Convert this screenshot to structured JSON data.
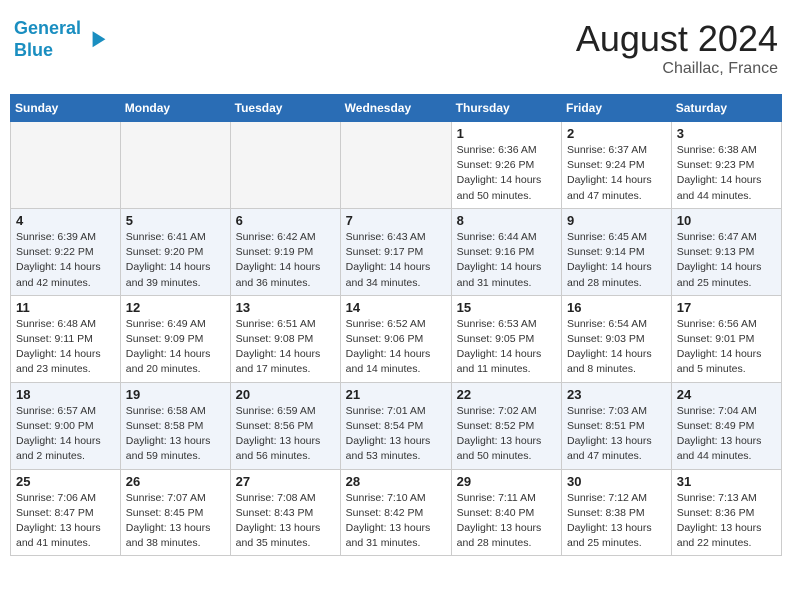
{
  "header": {
    "logo_line1": "General",
    "logo_line2": "Blue",
    "month": "August 2024",
    "location": "Chaillac, France"
  },
  "days_of_week": [
    "Sunday",
    "Monday",
    "Tuesday",
    "Wednesday",
    "Thursday",
    "Friday",
    "Saturday"
  ],
  "weeks": [
    [
      {
        "day": "",
        "info": ""
      },
      {
        "day": "",
        "info": ""
      },
      {
        "day": "",
        "info": ""
      },
      {
        "day": "",
        "info": ""
      },
      {
        "day": "1",
        "info": "Sunrise: 6:36 AM\nSunset: 9:26 PM\nDaylight: 14 hours\nand 50 minutes."
      },
      {
        "day": "2",
        "info": "Sunrise: 6:37 AM\nSunset: 9:24 PM\nDaylight: 14 hours\nand 47 minutes."
      },
      {
        "day": "3",
        "info": "Sunrise: 6:38 AM\nSunset: 9:23 PM\nDaylight: 14 hours\nand 44 minutes."
      }
    ],
    [
      {
        "day": "4",
        "info": "Sunrise: 6:39 AM\nSunset: 9:22 PM\nDaylight: 14 hours\nand 42 minutes."
      },
      {
        "day": "5",
        "info": "Sunrise: 6:41 AM\nSunset: 9:20 PM\nDaylight: 14 hours\nand 39 minutes."
      },
      {
        "day": "6",
        "info": "Sunrise: 6:42 AM\nSunset: 9:19 PM\nDaylight: 14 hours\nand 36 minutes."
      },
      {
        "day": "7",
        "info": "Sunrise: 6:43 AM\nSunset: 9:17 PM\nDaylight: 14 hours\nand 34 minutes."
      },
      {
        "day": "8",
        "info": "Sunrise: 6:44 AM\nSunset: 9:16 PM\nDaylight: 14 hours\nand 31 minutes."
      },
      {
        "day": "9",
        "info": "Sunrise: 6:45 AM\nSunset: 9:14 PM\nDaylight: 14 hours\nand 28 minutes."
      },
      {
        "day": "10",
        "info": "Sunrise: 6:47 AM\nSunset: 9:13 PM\nDaylight: 14 hours\nand 25 minutes."
      }
    ],
    [
      {
        "day": "11",
        "info": "Sunrise: 6:48 AM\nSunset: 9:11 PM\nDaylight: 14 hours\nand 23 minutes."
      },
      {
        "day": "12",
        "info": "Sunrise: 6:49 AM\nSunset: 9:09 PM\nDaylight: 14 hours\nand 20 minutes."
      },
      {
        "day": "13",
        "info": "Sunrise: 6:51 AM\nSunset: 9:08 PM\nDaylight: 14 hours\nand 17 minutes."
      },
      {
        "day": "14",
        "info": "Sunrise: 6:52 AM\nSunset: 9:06 PM\nDaylight: 14 hours\nand 14 minutes."
      },
      {
        "day": "15",
        "info": "Sunrise: 6:53 AM\nSunset: 9:05 PM\nDaylight: 14 hours\nand 11 minutes."
      },
      {
        "day": "16",
        "info": "Sunrise: 6:54 AM\nSunset: 9:03 PM\nDaylight: 14 hours\nand 8 minutes."
      },
      {
        "day": "17",
        "info": "Sunrise: 6:56 AM\nSunset: 9:01 PM\nDaylight: 14 hours\nand 5 minutes."
      }
    ],
    [
      {
        "day": "18",
        "info": "Sunrise: 6:57 AM\nSunset: 9:00 PM\nDaylight: 14 hours\nand 2 minutes."
      },
      {
        "day": "19",
        "info": "Sunrise: 6:58 AM\nSunset: 8:58 PM\nDaylight: 13 hours\nand 59 minutes."
      },
      {
        "day": "20",
        "info": "Sunrise: 6:59 AM\nSunset: 8:56 PM\nDaylight: 13 hours\nand 56 minutes."
      },
      {
        "day": "21",
        "info": "Sunrise: 7:01 AM\nSunset: 8:54 PM\nDaylight: 13 hours\nand 53 minutes."
      },
      {
        "day": "22",
        "info": "Sunrise: 7:02 AM\nSunset: 8:52 PM\nDaylight: 13 hours\nand 50 minutes."
      },
      {
        "day": "23",
        "info": "Sunrise: 7:03 AM\nSunset: 8:51 PM\nDaylight: 13 hours\nand 47 minutes."
      },
      {
        "day": "24",
        "info": "Sunrise: 7:04 AM\nSunset: 8:49 PM\nDaylight: 13 hours\nand 44 minutes."
      }
    ],
    [
      {
        "day": "25",
        "info": "Sunrise: 7:06 AM\nSunset: 8:47 PM\nDaylight: 13 hours\nand 41 minutes."
      },
      {
        "day": "26",
        "info": "Sunrise: 7:07 AM\nSunset: 8:45 PM\nDaylight: 13 hours\nand 38 minutes."
      },
      {
        "day": "27",
        "info": "Sunrise: 7:08 AM\nSunset: 8:43 PM\nDaylight: 13 hours\nand 35 minutes."
      },
      {
        "day": "28",
        "info": "Sunrise: 7:10 AM\nSunset: 8:42 PM\nDaylight: 13 hours\nand 31 minutes."
      },
      {
        "day": "29",
        "info": "Sunrise: 7:11 AM\nSunset: 8:40 PM\nDaylight: 13 hours\nand 28 minutes."
      },
      {
        "day": "30",
        "info": "Sunrise: 7:12 AM\nSunset: 8:38 PM\nDaylight: 13 hours\nand 25 minutes."
      },
      {
        "day": "31",
        "info": "Sunrise: 7:13 AM\nSunset: 8:36 PM\nDaylight: 13 hours\nand 22 minutes."
      }
    ]
  ]
}
